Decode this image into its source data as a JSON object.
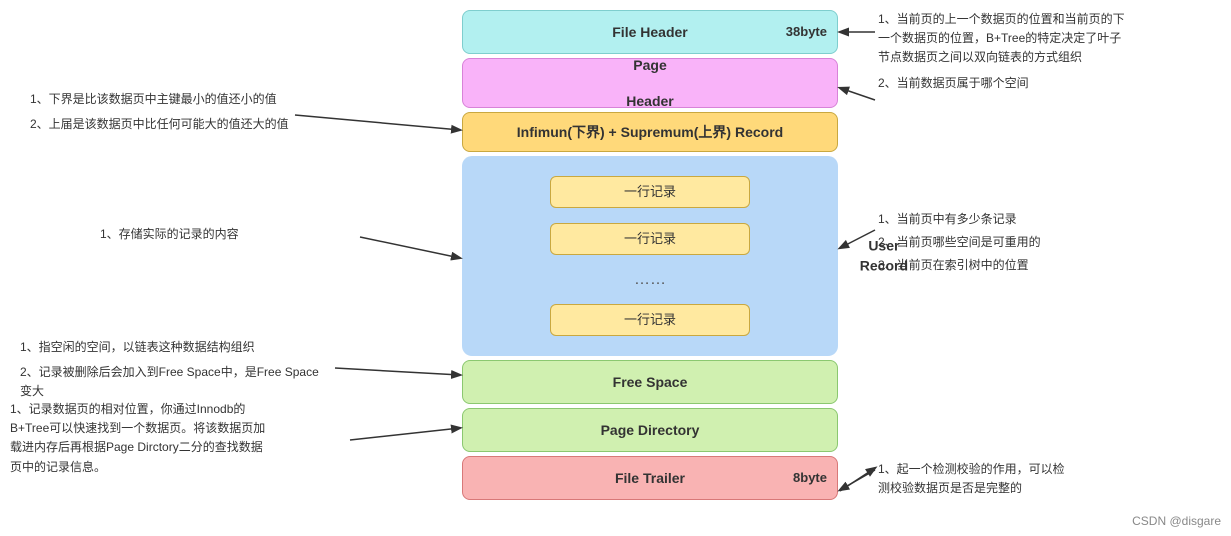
{
  "boxes": {
    "file_header": {
      "label": "File Header",
      "byte": "38byte",
      "bg": "#b2f0f0"
    },
    "page_header": {
      "label1": "Page",
      "label2": "Header"
    },
    "infimum": {
      "label": "Infimun(下界) + Supremum(上界) Record"
    },
    "user_record": {
      "row1": "一行记录",
      "row2": "一行记录",
      "dots": "……",
      "row3": "一行记录",
      "side_label1": "User",
      "side_label2": "Record"
    },
    "free_space": {
      "label": "Free Space"
    },
    "page_directory": {
      "label": "Page Directory"
    },
    "file_trailer": {
      "label": "File Trailer",
      "byte": "8byte"
    }
  },
  "annotations": {
    "left1": {
      "line1": "1、下界是比该数据页中主键最小的值还小的值",
      "line2": "2、上届是该数据页中比任何可能大的值还大的值"
    },
    "left2": {
      "line1": "1、存储实际的记录的内容"
    },
    "left3": {
      "line1": "1、指空闲的空间，以链表这种数据结构组织",
      "line2": "2、记录被删除后会加入到Free Space中，是Free Space 变大"
    },
    "left4": {
      "line1": "1、记录数据页的相对位置，你通过Innodb的",
      "line2": "B+Tree可以快速找到一个数据页。将该数据页加",
      "line3": "载进内存后再根据Page Dirctory二分的查找数据",
      "line4": "页中的记录信息。"
    },
    "right1": {
      "line1": "1、当前页的上一个数据页的位置和当前页的下",
      "line2": "一个数据页的位置，B+Tree的特定决定了叶子",
      "line3": "节点数据页之间以双向链表的方式组织",
      "line4": "2、当前数据页属于哪个空间"
    },
    "right2": {
      "line1": "1、当前页中有多少条记录",
      "line2": "2、当前页哪些空间是可重用的",
      "line3": "3、当前页在索引树中的位置"
    },
    "right3": {
      "line1": "1、起一个检测校验的作用，可以检",
      "line2": "测校验数据页是否是完整的"
    }
  },
  "watermark": "CSDN @disgare"
}
